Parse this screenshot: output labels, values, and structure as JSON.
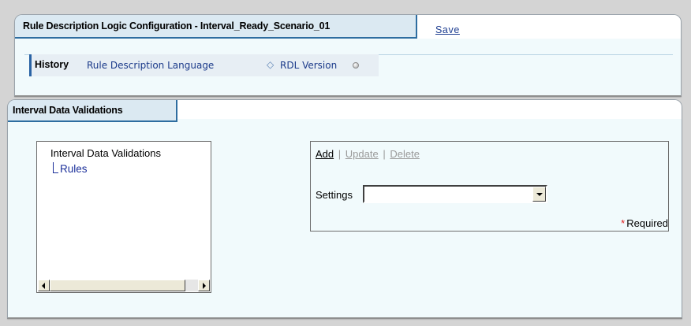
{
  "config_panel": {
    "title": "Rule Description Logic Configuration - Interval_Ready_Scenario_01",
    "save_label": "Save"
  },
  "history": {
    "label": "History",
    "crumbs": [
      "Rule Description Language",
      "RDL Version"
    ],
    "separator": "◇"
  },
  "validation_panel": {
    "title": "Interval Data Validations",
    "tree": {
      "root": "Interval Data Validations",
      "children": [
        "Rules"
      ]
    },
    "actions": {
      "add": "Add",
      "update": "Update",
      "delete": "Delete",
      "separator": "|"
    },
    "settings": {
      "label": "Settings",
      "value": ""
    },
    "required": {
      "star": "*",
      "label": "Required"
    }
  },
  "colors": {
    "panel_bg": "#f1fafc",
    "tab_bg": "#dbe9f2",
    "accent_border": "#2e6da0",
    "link_blue": "#1b3a8a",
    "required_star": "#e02020",
    "disabled_text": "#9a9a9a"
  },
  "icons": {
    "crumb_separator": "diamond-icon",
    "crumb_end": "circle-icon",
    "tree_connector": "tree-elbow-icon",
    "scroll_left": "arrow-left-icon",
    "scroll_right": "arrow-right-icon",
    "dropdown": "chevron-down-icon"
  }
}
